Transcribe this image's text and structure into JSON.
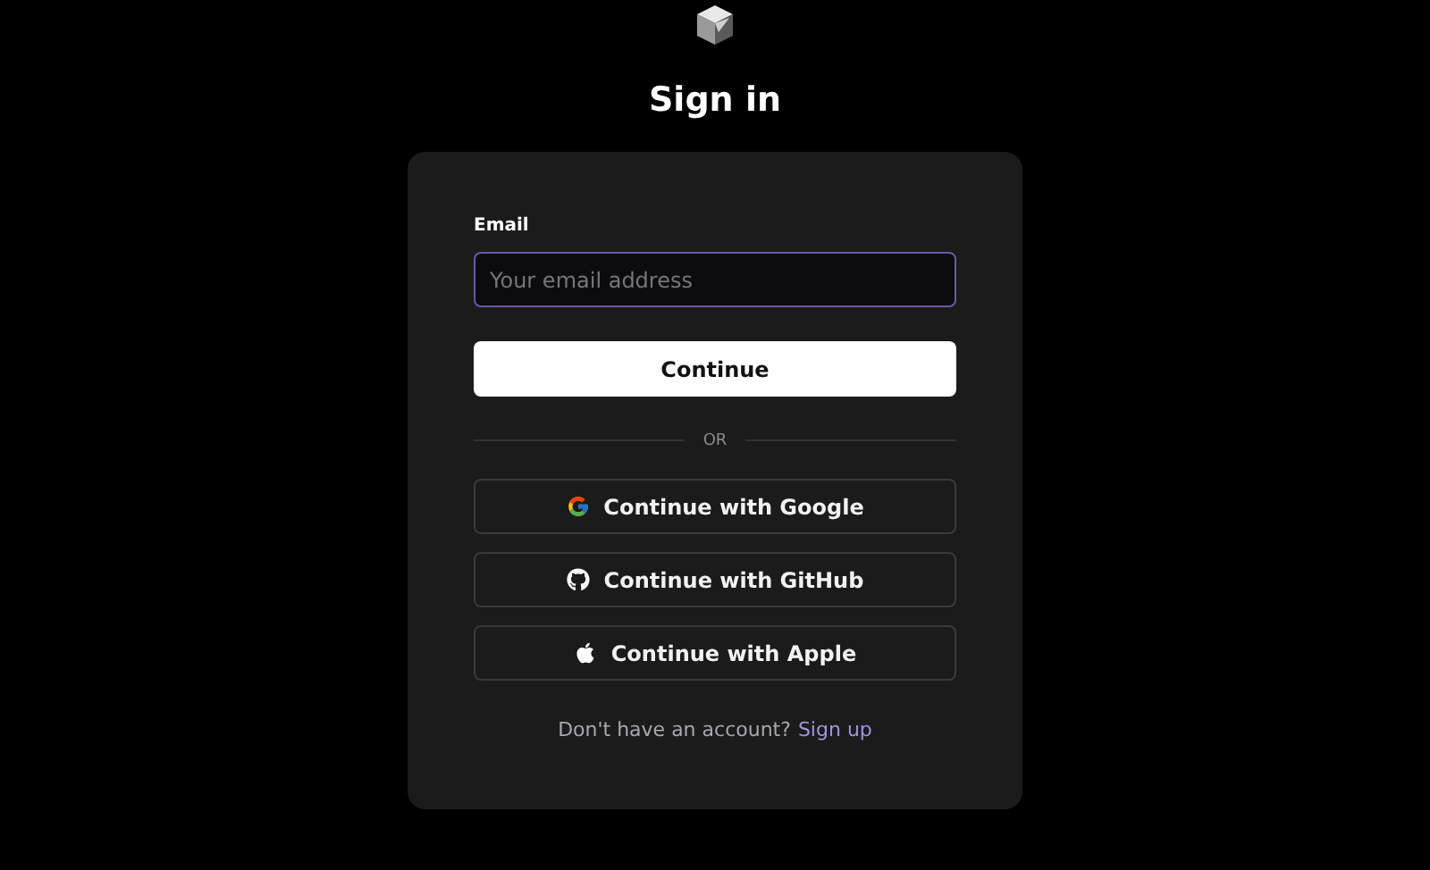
{
  "title": "Sign in",
  "form": {
    "email_label": "Email",
    "email_field": {
      "placeholder": "Your email address",
      "focused": true
    },
    "continue_button": "Continue",
    "divider": "OR",
    "providers": [
      {
        "kind": "google",
        "label": "Continue with Google"
      },
      {
        "kind": "github",
        "label": "Continue with GitHub"
      },
      {
        "kind": "apple",
        "label": "Continue with Apple"
      }
    ],
    "footer": {
      "text": "Don't have an account?",
      "link": "Sign up"
    }
  }
}
